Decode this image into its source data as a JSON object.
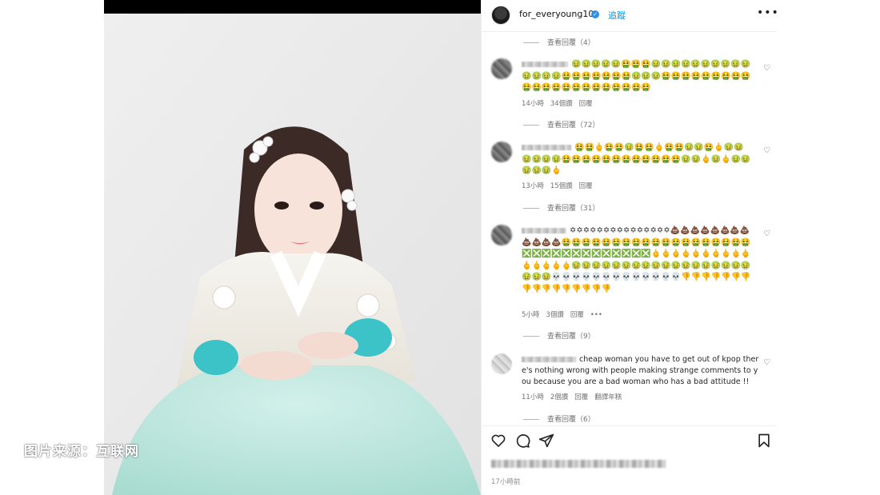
{
  "header": {
    "username": "for_everyoung10",
    "follow_label": "追蹤",
    "more_label": "•••"
  },
  "watermark": "图片来源：互联网",
  "comments": [
    {
      "replies_label": "查看回覆（4）"
    },
    {
      "emoji": "🤢🤢🤢🤢🤢🤮🤮🤮🤢🤢🤢🤢🤢🤢🤢🤢🤢🤢🤢🤢🤢🤢🤮🤮🤮🤮🤮🤮🤮🤢🤢🤢🤮🤮🤮🤮🤮🤮🤮🤮🤮🤮🤮🤮🤮🤮🤮🤮🤮🤮🤮🤮🤮🤮",
      "time": "14小時",
      "likes": "34個讚",
      "reply": "回覆",
      "replies_label": "查看回覆（72）"
    },
    {
      "emoji": "🤮🤮🖕🤮🤮🤢🤮🤮🖕🤮🤮🤢🤢🤮🖕🤢🤢🤢🤢🤢🤢🤮🤮🤮🤮🤮🤮🤮🤮🤮🤮🤮🤮🤢🤢🖕🤢🖕🤢🤢🤢🤢🤢🖕",
      "time": "13小時",
      "likes": "15個讚",
      "reply": "回覆",
      "replies_label": "查看回覆（31）"
    },
    {
      "emoji": "✡✡✡✡✡✡✡✡✡✡✡✡✡✡✡💩💩💩💩💩💩💩💩💩💩💩💩🤮🤮🤮🤮🤮🤮🤮🤮🤮🤮🤮🤮🤮🤮🤮🤮🤮🤮🤮❎❎❎❎❎❎❎❎❎❎❎❎❎🖕🖕🖕🖕🖕🖕🖕🖕🖕🖕🖕🖕🖕🖕🖕🤢🤢🤢🤢🤢🤢🤢🤢🤢🤢🤢🤢🤢🤢🤢🤢🤢🤢🤢🤢🤢💀💀💀💀💀💀💀💀💀💀💀💀💀👎👎👎👎👎👎👎👎👎👎👎👎👎👎👎👎",
      "time": "5小時",
      "likes": "3個讚",
      "reply": "回覆",
      "more": "•••",
      "replies_label": "查看回覆（9）"
    },
    {
      "text": "cheap woman you have to get out of kpop there's nothing wrong with people making strange comments to you because you are a bad woman who has a bad attitude !!",
      "time": "11小時",
      "likes": "2個讚",
      "reply": "回覆",
      "translate": "翻譯年糕",
      "replies_label": "查看回覆（6）"
    }
  ],
  "footer": {
    "time_ago": "17小時前"
  },
  "icons": {
    "like": "heart-outline-icon",
    "comment": "comment-bubble-icon",
    "share": "paper-plane-icon",
    "save": "bookmark-icon"
  }
}
